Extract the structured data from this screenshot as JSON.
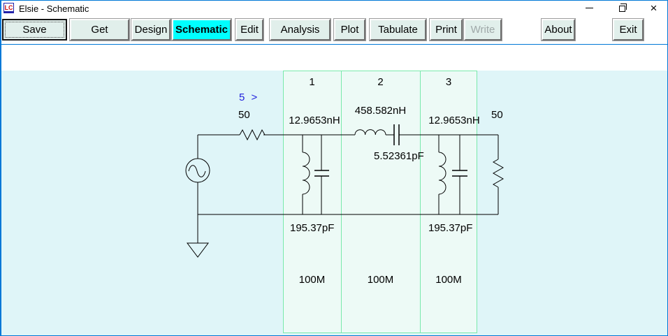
{
  "window": {
    "title": "Elsie - Schematic",
    "icon_label": "LC",
    "close_glyph": "×"
  },
  "toolbar": {
    "buttons": [
      {
        "label": "Save"
      },
      {
        "label": "Get"
      },
      {
        "label": "Design"
      },
      {
        "label": "Schematic"
      },
      {
        "label": "Edit"
      },
      {
        "label": "Analysis"
      },
      {
        "label": "Plot"
      },
      {
        "label": "Tabulate"
      },
      {
        "label": "Print"
      },
      {
        "label": "Write"
      },
      {
        "label": "About"
      },
      {
        "label": "Exit"
      }
    ],
    "active_button": "Schematic",
    "disabled_button": "Write"
  },
  "schematic": {
    "order_marker": "5 >",
    "source_impedance": "50",
    "load_impedance": "50",
    "sections": [
      {
        "number": "1",
        "frequency": "100M"
      },
      {
        "number": "2",
        "frequency": "100M"
      },
      {
        "number": "3",
        "frequency": "100M"
      }
    ],
    "values": {
      "l1": "12.9653nH",
      "c1": "195.37pF",
      "l2": "458.582nH",
      "c2": "5.52361pF",
      "l3": "12.9653nH",
      "c3": "195.37pF"
    }
  },
  "colors": {
    "active_tab": "#00FFFF",
    "canvas_background": "#DFF5F8",
    "section_background": "#EDFAF6",
    "section_border": "#79E9AC",
    "window_border": "#0078D7",
    "order_marker_text": "#2222DD"
  }
}
